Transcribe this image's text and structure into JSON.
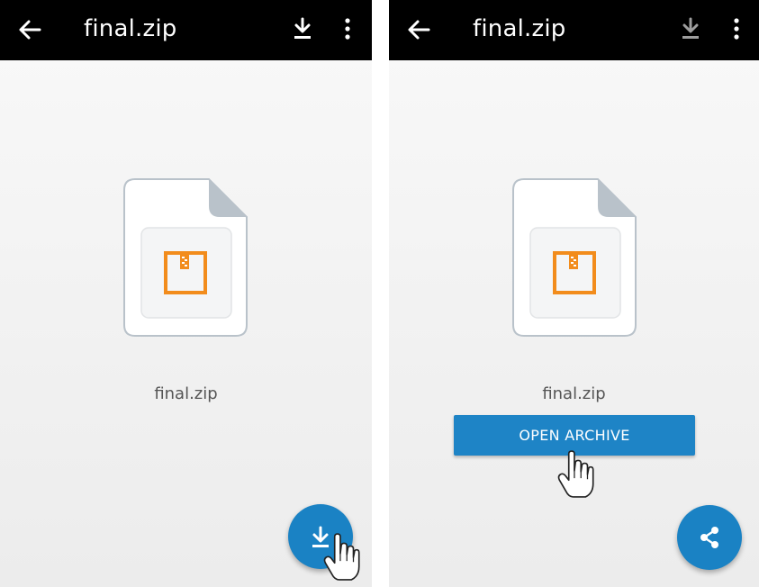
{
  "left_screen": {
    "title": "final.zip",
    "filename": "final.zip",
    "icons": [
      "back-arrow-icon",
      "download-icon",
      "more-vert-icon",
      "zip-file-icon",
      "download-icon",
      "pointer-hand-icon"
    ]
  },
  "right_screen": {
    "title": "final.zip",
    "filename": "final.zip",
    "open_button_label": "OPEN ARCHIVE",
    "icons": [
      "back-arrow-icon",
      "download-icon",
      "more-vert-icon",
      "zip-file-icon",
      "share-icon",
      "pointer-hand-icon"
    ]
  },
  "colors": {
    "appbar": "#000000",
    "accent_blue": "#1a82c4",
    "zip_orange": "#f28c1c",
    "download_disabled": "#9e9e9e"
  }
}
